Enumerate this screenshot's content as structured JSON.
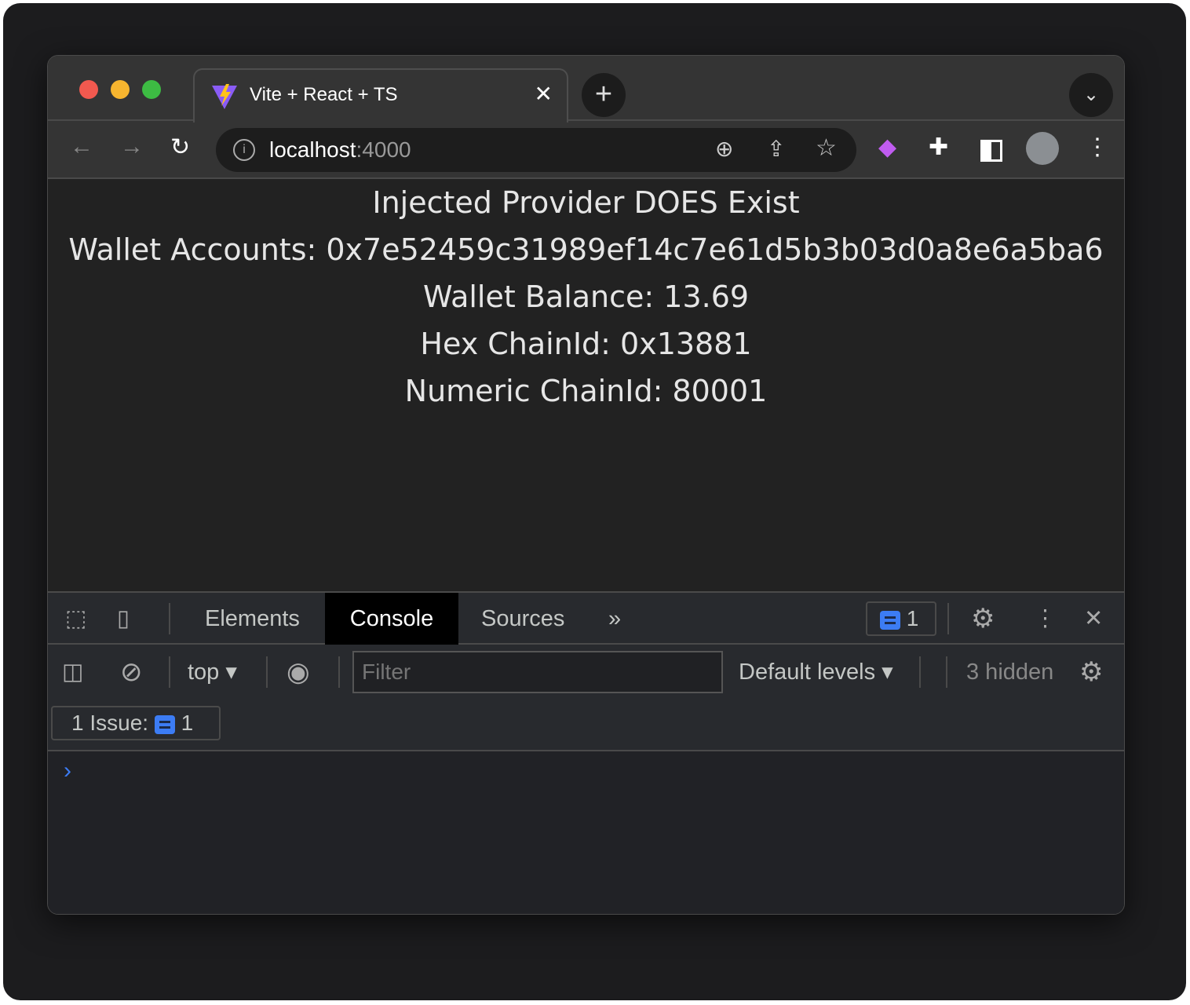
{
  "browser": {
    "tab_title": "Vite + React + TS",
    "url_host": "localhost",
    "url_port": ":4000"
  },
  "content": {
    "lines": [
      "Injected Provider DOES Exist",
      "Wallet Accounts: 0x7e52459c31989ef14c7e61d5b3b03d0a8e6a5ba6",
      "Wallet Balance: 13.69",
      "Hex ChainId: 0x13881",
      "Numeric ChainId: 80001"
    ]
  },
  "devtools": {
    "tabs": [
      "Elements",
      "Console",
      "Sources"
    ],
    "active_tab": "Console",
    "issues_badge": "1",
    "context": "top",
    "filter_placeholder": "Filter",
    "levels": "Default levels",
    "hidden": "3 hidden",
    "issues_label": "1 Issue:",
    "issues_count": "1",
    "accent": "#3c7cf4"
  }
}
